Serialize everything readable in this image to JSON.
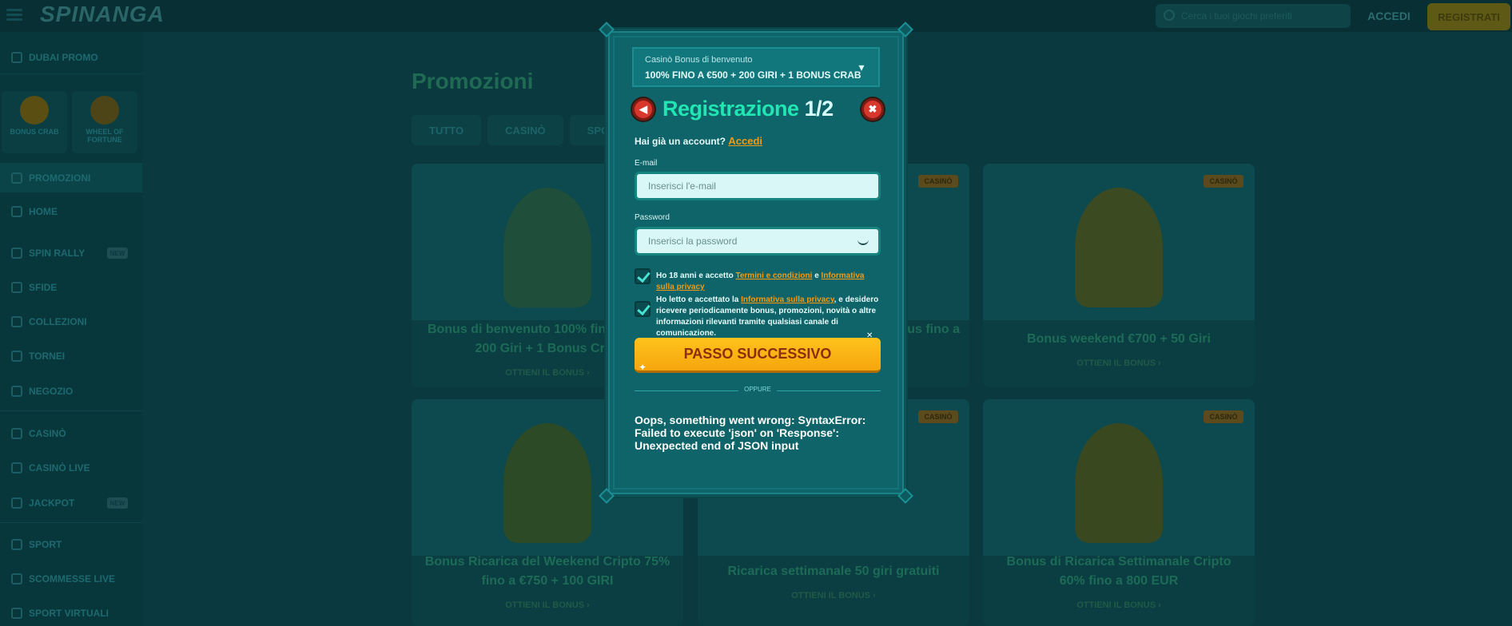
{
  "topbar": {
    "logo_text": "SPINANGA",
    "search_placeholder": "Cerca i tuoi giochi preferiti",
    "login_label": "ACCEDI",
    "register_label": "REGISTRATI"
  },
  "sidebar": {
    "promo_label": "DUBAI PROMO",
    "tiles": [
      {
        "label": "BONUS CRAB",
        "icon": "crab-bonus-icon"
      },
      {
        "label": "WHEEL OF FORTUNE",
        "icon": "wheel-icon"
      }
    ],
    "items": [
      {
        "label": "PROMOZIONI",
        "icon": "gift-icon"
      },
      {
        "label": "HOME",
        "icon": "home-icon"
      },
      {
        "label": "SPIN RALLY",
        "icon": "flag-icon",
        "badge": "NEW"
      },
      {
        "label": "SFIDE",
        "icon": "target-icon"
      },
      {
        "label": "COLLEZIONI",
        "icon": "collection-icon"
      },
      {
        "label": "TORNEI",
        "icon": "trophy-icon"
      },
      {
        "label": "NEGOZIO",
        "icon": "shop-icon"
      },
      {
        "label": "CASINÒ",
        "icon": "casino-icon"
      },
      {
        "label": "CASINÒ LIVE",
        "icon": "live-icon"
      },
      {
        "label": "JACKPOT",
        "icon": "jackpot-icon",
        "badge": "NEW"
      },
      {
        "label": "SPORT",
        "icon": "ball-icon"
      },
      {
        "label": "SCOMMESSE LIVE",
        "icon": "live-bet-icon"
      },
      {
        "label": "SPORT VIRTUALI",
        "icon": "virtual-icon"
      }
    ]
  },
  "main": {
    "title": "Promozioni",
    "tabs": [
      "TUTTO",
      "CASINÒ",
      "SPORT"
    ],
    "cards": [
      {
        "title": "Bonus di benvenuto 100% fino a €500 + 200 Giri + 1 Bonus Crab",
        "cta": "OTTIENI IL BONUS ›",
        "tag": ""
      },
      {
        "title": "Bonus fino a",
        "cta": "",
        "tag": "CASINÒ"
      },
      {
        "title": "Bonus weekend €700 + 50 Giri",
        "cta": "OTTIENI IL BONUS ›",
        "tag": "CASINÒ"
      },
      {
        "title": "Bonus Ricarica del Weekend Cripto 75% fino a €750 + 100 GIRI",
        "cta": "OTTIENI IL BONUS ›",
        "tag": ""
      },
      {
        "title": "Ricarica settimanale 50 giri gratuiti",
        "cta": "OTTIENI IL BONUS ›",
        "tag": "CASINÒ"
      },
      {
        "title": "Bonus di Ricarica Settimanale Cripto 60% fino a 800 EUR",
        "cta": "OTTIENI IL BONUS ›",
        "tag": "CASINÒ"
      }
    ]
  },
  "modal": {
    "bonus_label": "Casinò Bonus di benvenuto",
    "bonus_value": "100% FINO A €500 + 200 GIRI + 1 BONUS CRAB",
    "title": "Registrazione",
    "step": "1/2",
    "have_account": "Hai già un account?",
    "login_link": "Accedi",
    "email_label": "E-mail",
    "email_placeholder": "Inserisci l'e-mail",
    "password_label": "Password",
    "password_placeholder": "Inserisci la password",
    "terms_prefix": "Ho 18 anni e accetto",
    "terms_link": "Termini e condizioni",
    "terms_and": "e",
    "privacy_link": "Informativa sulla privacy",
    "marketing_prefix": "Ho letto e accettato la",
    "marketing_link": "Informativa sulla privacy",
    "marketing_suffix": ", e desidero ricevere periodicamente bonus, promozioni, novità o altre informazioni rilevanti tramite qualsiasi canale di comunicazione.",
    "next_button": "PASSO SUCCESSIVO",
    "or_label": "OPPURE",
    "error": "Oops, something went wrong: SyntaxError: Failed to execute 'json' on 'Response': Unexpected end of JSON input"
  },
  "colors": {
    "accent_teal": "#21e5b2",
    "link_orange": "#f59a10",
    "cta_yellow": "#ffc21c",
    "close_red": "#d8372c"
  }
}
